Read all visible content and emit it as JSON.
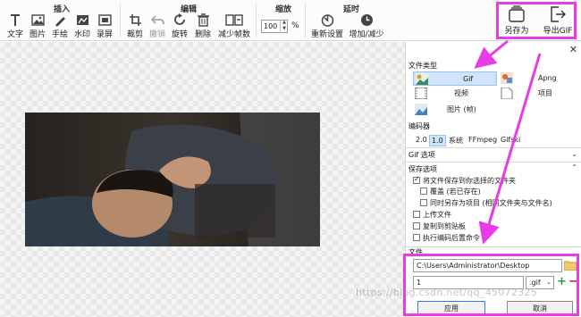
{
  "ribbon": {
    "groups": [
      {
        "title": "插入",
        "buttons": [
          {
            "label": "文字",
            "icon": "text-icon"
          },
          {
            "label": "图片",
            "icon": "image-icon"
          },
          {
            "label": "手绘",
            "icon": "pencil-icon"
          },
          {
            "label": "水印",
            "icon": "watermark-icon"
          },
          {
            "label": "录屏",
            "icon": "record-icon"
          }
        ]
      },
      {
        "title": "编辑",
        "buttons": [
          {
            "label": "裁剪",
            "icon": "crop-icon"
          },
          {
            "label": "撤销",
            "icon": "undo-icon"
          },
          {
            "label": "旋转",
            "icon": "rotate-icon"
          },
          {
            "label": "删除",
            "icon": "trash-icon"
          },
          {
            "label": "减少帧数",
            "icon": "reduce-frames-icon"
          }
        ]
      },
      {
        "title": "缩放",
        "zoom_value": "100",
        "zoom_unit": "%"
      },
      {
        "title": "延时",
        "buttons": [
          {
            "label": "重新设置",
            "icon": "reset-delay-icon"
          },
          {
            "label": "增加/减少",
            "icon": "clock-icon"
          }
        ]
      }
    ],
    "save_as": "另存为",
    "export_gif": "导出GIF"
  },
  "panel": {
    "close": "✕",
    "file_type_heading": "文件类型",
    "file_types": [
      {
        "label": "Gif",
        "selected": true
      },
      {
        "label": "Apng",
        "selected": false
      },
      {
        "label": "视频",
        "selected": false
      },
      {
        "label": "项目",
        "selected": false
      },
      {
        "label": "图片 (帧)",
        "selected": false
      }
    ],
    "encoder_heading": "编码器",
    "encoders": [
      "2.0",
      "1.0",
      "系统",
      "FFmpeg",
      "Gifski"
    ],
    "encoder_selected": "1.0",
    "gif_options_heading": "Gif 选项",
    "save_options_heading": "保存选项",
    "save_options": [
      {
        "label": "将文件保存到你选择的文件夹",
        "checked": true
      },
      {
        "label": "覆盖 (若已存在)",
        "checked": false
      },
      {
        "label": "同时另存为项目 (相同文件夹与文件名)",
        "checked": false
      },
      {
        "label": "上传文件",
        "checked": false
      },
      {
        "label": "复制到剪贴板",
        "checked": false
      },
      {
        "label": "执行编码后置命令",
        "checked": false
      }
    ],
    "file_heading": "文件",
    "path_value": "C:\\Users\\Administrator\\Desktop",
    "filename_value": "1",
    "extension_value": ".gif",
    "apply_button": "应用",
    "cancel_button": "取消"
  },
  "watermark": "https://blog.csdn.net/qq_45072325",
  "colors": {
    "annotation": "#e83ce8",
    "selection": "#cfe3fb",
    "accent": "#3a7bd5"
  }
}
